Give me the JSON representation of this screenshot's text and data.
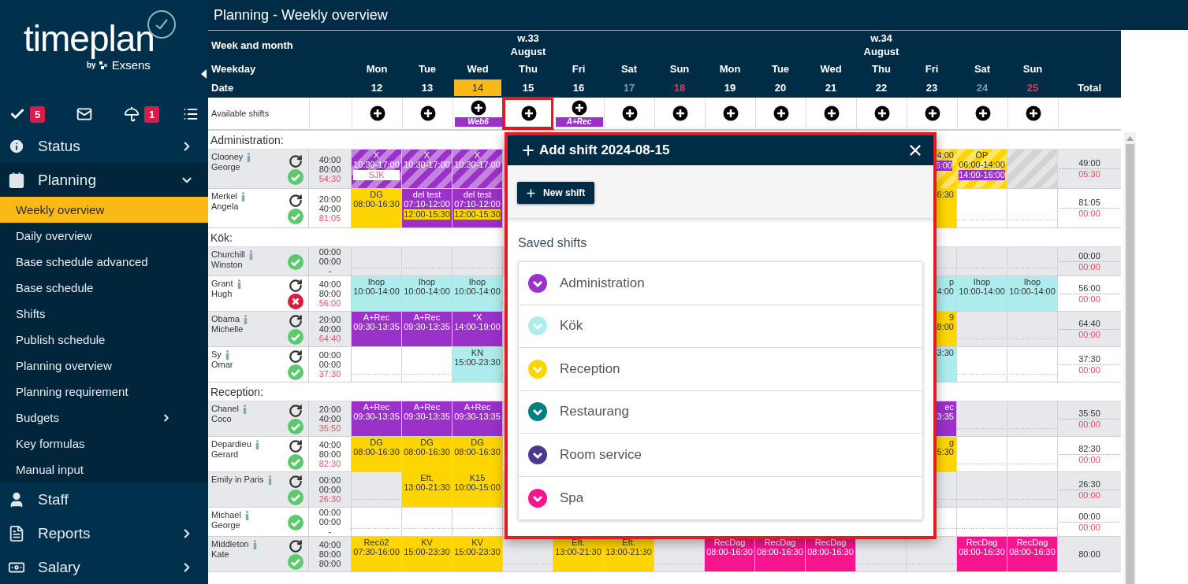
{
  "logo": {
    "name": "timeplan",
    "by": "by",
    "company": "Exsens"
  },
  "quick_icons": [
    {
      "kind": "tasks",
      "badge": "5"
    },
    {
      "kind": "mail"
    },
    {
      "kind": "vacation",
      "badge": "1"
    },
    {
      "kind": "list"
    }
  ],
  "menu": [
    {
      "label": "Status",
      "kind": "info",
      "expandable": true,
      "expanded": false
    },
    {
      "label": "Planning",
      "kind": "calendar",
      "expandable": true,
      "expanded": true,
      "children": [
        {
          "label": "Weekly overview",
          "selected": true
        },
        {
          "label": "Daily overview",
          "selected": false
        },
        {
          "label": "Base schedule advanced",
          "selected": false
        },
        {
          "label": "Base schedule",
          "selected": false
        },
        {
          "label": "Shifts",
          "selected": false
        },
        {
          "label": "Publish schedule",
          "selected": false
        },
        {
          "label": "Planning overview",
          "selected": false
        },
        {
          "label": "Planning requirement",
          "selected": false
        },
        {
          "label": "Budgets",
          "selected": false,
          "expandable": true
        },
        {
          "label": "Key formulas",
          "selected": false
        },
        {
          "label": "Manual input",
          "selected": false
        }
      ]
    },
    {
      "label": "Staff",
      "kind": "user",
      "expandable": false,
      "expanded": false
    },
    {
      "label": "Reports",
      "kind": "document",
      "expandable": true,
      "expanded": false
    },
    {
      "label": "Salary",
      "kind": "money",
      "expandable": true,
      "expanded": false
    }
  ],
  "page_title": "Planning - Weekly overview",
  "grid": {
    "labels": {
      "week": "Week and month",
      "weekday": "Weekday",
      "date": "Date",
      "total": "Total",
      "available": "Available shifts"
    },
    "weeks": [
      {
        "label": "w.33",
        "month": "August",
        "days": [
          {
            "weekday": "Mon",
            "date": "12",
            "kind": "weekday",
            "today": false
          },
          {
            "weekday": "Tue",
            "date": "13",
            "kind": "weekday",
            "today": false
          },
          {
            "weekday": "Wed",
            "date": "14",
            "kind": "weekday",
            "today": true
          },
          {
            "weekday": "Thu",
            "date": "15",
            "kind": "weekday",
            "today": false
          },
          {
            "weekday": "Fri",
            "date": "16",
            "kind": "weekday",
            "today": false
          },
          {
            "weekday": "Sat",
            "date": "17",
            "kind": "saturday",
            "today": false
          },
          {
            "weekday": "Sun",
            "date": "18",
            "kind": "sunday",
            "today": false
          }
        ]
      },
      {
        "label": "w.34",
        "month": "August",
        "days": [
          {
            "weekday": "Mon",
            "date": "19",
            "kind": "weekday",
            "today": false
          },
          {
            "weekday": "Tue",
            "date": "20",
            "kind": "weekday",
            "today": false
          },
          {
            "weekday": "Wed",
            "date": "21",
            "kind": "weekday",
            "today": false
          },
          {
            "weekday": "Thu",
            "date": "22",
            "kind": "weekday",
            "today": false
          },
          {
            "weekday": "Fri",
            "date": "23",
            "kind": "weekday",
            "today": false
          },
          {
            "weekday": "Sat",
            "date": "24",
            "kind": "saturday",
            "today": false
          },
          {
            "weekday": "Sun",
            "date": "25",
            "kind": "sunday",
            "today": false
          }
        ]
      }
    ],
    "available": [
      {
        "selected": false
      },
      {
        "selected": false
      },
      {
        "selected": false,
        "tag": "Web6"
      },
      {
        "selected": true
      },
      {
        "selected": false,
        "tag": "A+Rec"
      },
      {
        "selected": false
      },
      {
        "selected": false
      },
      {
        "selected": false
      },
      {
        "selected": false
      },
      {
        "selected": false
      },
      {
        "selected": false
      },
      {
        "selected": false
      },
      {
        "selected": false
      },
      {
        "selected": false
      }
    ],
    "sections": [
      {
        "title": "Administration:",
        "staff": [
          {
            "last": "Clooney",
            "first": "George",
            "info": true,
            "recurring": true,
            "approved": true,
            "hours": [
              "40:00",
              "80:00",
              "54:30"
            ],
            "balance_alert": true,
            "cells": [
              {
                "color": "#9a31c9",
                "striped": true,
                "lines": [
                  "X",
                  "10:30-17:00"
                ],
                "tag": {
                  "text": "SJK",
                  "color": "#ffffff"
                }
              },
              {
                "color": "#9a31c9",
                "striped": true,
                "lines": [
                  "X",
                  "10:30-17:00"
                ]
              },
              {
                "color": "#9a31c9",
                "striped": true,
                "lines": [
                  "X",
                  "10:30-17:00"
                ]
              },
              {},
              {},
              {},
              {},
              {},
              {},
              {},
              {},
              {
                "color": "#ffd500",
                "striped": true,
                "lines": [
                  "4:00"
                ],
                "tag": {
                  "text": "6:00",
                  "color": "#9a31c9"
                },
                "cut": true
              },
              {
                "color": "#ffd500",
                "striped": true,
                "lines": [
                  "ÖP",
                  "06:00-14:00"
                ],
                "tag": {
                  "text": "14:00-16:00",
                  "color": "#9a31c9"
                }
              },
              {
                "color": "#d3d3d3",
                "striped": true
              }
            ],
            "total": [
              "49:00",
              "05:30"
            ]
          },
          {
            "last": "Merkel",
            "first": "Angela",
            "info": true,
            "recurring": true,
            "approved": true,
            "hours": [
              "20:00",
              "40:00",
              "81:05"
            ],
            "balance_alert": true,
            "cells": [
              {
                "color": "#ffd500",
                "striped": false,
                "lines": [
                  "DG",
                  "08:00-16:30"
                ]
              },
              {
                "color": "#9a31c9",
                "striped": false,
                "lines": [
                  "del test",
                  "07:10-12:00"
                ],
                "tag": {
                  "text": "12:00-15:30",
                  "color": "#ffd500"
                }
              },
              {
                "color": "#9a31c9",
                "striped": false,
                "lines": [
                  "del test",
                  "07:10-12:00"
                ],
                "tag": {
                  "text": "12:00-15:30",
                  "color": "#ffd500"
                }
              },
              {},
              {},
              {},
              {},
              {},
              {},
              {},
              {},
              {
                "color": "#ffd500",
                "striped": false,
                "lines": [
                  "6:30"
                ],
                "cut": true
              },
              {},
              {}
            ],
            "total": [
              "81:05",
              "00:00"
            ]
          }
        ]
      },
      {
        "title": "Kök:",
        "staff": [
          {
            "last": "Churchill",
            "first": "Winston",
            "info": true,
            "recurring": false,
            "approved": true,
            "hours": [
              "00:00",
              "00:00",
              "-"
            ],
            "balance_alert": false,
            "cells": [
              {},
              {},
              {},
              {},
              {},
              {},
              {},
              {},
              {},
              {},
              {},
              {},
              {},
              {}
            ],
            "total": [
              "00:00",
              "00:00"
            ]
          },
          {
            "last": "Grant",
            "first": "Hugh",
            "info": true,
            "recurring": true,
            "approved": false,
            "hours": [
              "40:00",
              "80:00",
              "56:00"
            ],
            "balance_alert": true,
            "cells": [
              {
                "color": "#aeeced",
                "striped": false,
                "lines": [
                  "Ihop",
                  "10:00-14:00"
                ]
              },
              {
                "color": "#aeeced",
                "striped": false,
                "lines": [
                  "Ihop",
                  "10:00-14:00"
                ]
              },
              {
                "color": "#aeeced",
                "striped": false,
                "lines": [
                  "Ihop",
                  "10:00-14:00"
                ]
              },
              {},
              {},
              {},
              {},
              {},
              {},
              {},
              {},
              {
                "color": "#aeeced",
                "striped": false,
                "lines": [
                  "p",
                  "4:00"
                ],
                "cut": true
              },
              {
                "color": "#aeeced",
                "striped": false,
                "lines": [
                  "Ihop",
                  "10:00-14:00"
                ]
              },
              {
                "color": "#aeeced",
                "striped": false,
                "lines": [
                  "Ihop",
                  "10:00-14:00"
                ]
              }
            ],
            "total": [
              "56:00",
              "00:00"
            ]
          },
          {
            "last": "Obama",
            "first": "Michelle",
            "info": true,
            "recurring": true,
            "approved": true,
            "hours": [
              "20:00",
              "40:00",
              "64:40"
            ],
            "balance_alert": true,
            "cells": [
              {
                "color": "#9a31c9",
                "striped": false,
                "lines": [
                  "A+Rec",
                  "09:30-13:35"
                ]
              },
              {
                "color": "#9a31c9",
                "striped": false,
                "lines": [
                  "A+Rec",
                  "09:30-13:35"
                ]
              },
              {
                "color": "#9a31c9",
                "striped": false,
                "lines": [
                  "*X",
                  "14:00-19:00"
                ]
              },
              {},
              {},
              {},
              {},
              {},
              {},
              {},
              {},
              {
                "color": "#ffd500",
                "striped": false,
                "lines": [
                  "9",
                  "8:00"
                ],
                "cut": true
              },
              {},
              {}
            ],
            "total": [
              "64:40",
              "00:00"
            ]
          },
          {
            "last": "Sy",
            "first": "Omar",
            "info": true,
            "recurring": true,
            "approved": true,
            "hours": [
              "00:00",
              "00:00",
              "37:30"
            ],
            "balance_alert": true,
            "cells": [
              {},
              {},
              {
                "color": "#aeeced",
                "striped": false,
                "lines": [
                  "KN",
                  "15:00-23:30"
                ]
              },
              {},
              {},
              {},
              {},
              {},
              {},
              {},
              {},
              {
                "color": "#aeeced",
                "striped": false,
                "lines": [
                  "3:30"
                ],
                "cut": true
              },
              {},
              {}
            ],
            "total": [
              "37:30",
              "00:00"
            ]
          }
        ]
      },
      {
        "title": "Reception:",
        "staff": [
          {
            "last": "Chanel",
            "first": "Coco",
            "info": true,
            "recurring": true,
            "approved": true,
            "hours": [
              "20:00",
              "40:00",
              "35:50"
            ],
            "balance_alert": true,
            "cells": [
              {
                "color": "#9a31c9",
                "striped": false,
                "lines": [
                  "A+Rec",
                  "09:30-13:35"
                ]
              },
              {
                "color": "#9a31c9",
                "striped": false,
                "lines": [
                  "A+Rec",
                  "09:30-13:35"
                ]
              },
              {
                "color": "#9a31c9",
                "striped": false,
                "lines": [
                  "A+Rec",
                  "09:30-13:35"
                ]
              },
              {},
              {},
              {},
              {},
              {},
              {},
              {},
              {},
              {
                "color": "#9a31c9",
                "striped": false,
                "lines": [
                  "ec",
                  "3:35"
                ],
                "cut": true
              },
              {},
              {}
            ],
            "total": [
              "35:50",
              "00:00"
            ]
          },
          {
            "last": "Depardieu",
            "first": "Gerard",
            "info": true,
            "recurring": true,
            "approved": true,
            "hours": [
              "40:00",
              "80:00",
              "82:30"
            ],
            "balance_alert": true,
            "cells": [
              {
                "color": "#ffd500",
                "striped": false,
                "lines": [
                  "DG",
                  "08:00-16:30"
                ]
              },
              {
                "color": "#ffd500",
                "striped": false,
                "lines": [
                  "DG",
                  "08:00-16:30"
                ]
              },
              {
                "color": "#ffd500",
                "striped": false,
                "lines": [
                  "DG",
                  "08:00-16:30"
                ]
              },
              {},
              {},
              {},
              {},
              {},
              {},
              {},
              {},
              {
                "color": "#ffd500",
                "striped": false,
                "lines": [
                  "g",
                  "5:30"
                ],
                "cut": true
              },
              {},
              {}
            ],
            "total": [
              "82:30",
              "00:00"
            ]
          },
          {
            "last": "Emily in Paris",
            "info": true,
            "recurring": true,
            "approved": true,
            "hours": [
              "00:00",
              "00:00",
              "26:30"
            ],
            "balance_alert": true,
            "cells": [
              {},
              {
                "color": "#ffd500",
                "striped": false,
                "lines": [
                  "Eft.",
                  "13:00-21:30"
                ]
              },
              {
                "color": "#ffd500",
                "striped": false,
                "lines": [
                  "K15",
                  "10:00-15:00"
                ]
              },
              {},
              {},
              {},
              {},
              {},
              {},
              {},
              {},
              {},
              {},
              {}
            ],
            "total": [
              "26:30",
              "00:00"
            ]
          },
          {
            "last": "Michael",
            "first": "George",
            "info": true,
            "recurring": false,
            "approved": true,
            "hours": [
              "00:00",
              "00:00",
              "-"
            ],
            "balance_alert": false,
            "cells": [
              {},
              {},
              {},
              {},
              {},
              {},
              {},
              {},
              {},
              {},
              {},
              {},
              {},
              {}
            ],
            "total": [
              "00:00",
              "00:00"
            ]
          },
          {
            "last": "Middleton",
            "first": "Kate",
            "info": true,
            "recurring": true,
            "approved": true,
            "hours": [
              "40:00",
              "80:00",
              "80:00"
            ],
            "balance_alert": false,
            "cells": [
              {
                "color": "#ffd500",
                "striped": false,
                "lines": [
                  "Recö2",
                  "07:30-16:00"
                ]
              },
              {
                "color": "#ffd500",
                "striped": false,
                "lines": [
                  "KV",
                  "15:00-23:30"
                ]
              },
              {
                "color": "#ffd500",
                "striped": false,
                "lines": [
                  "KV",
                  "15:00-23:30"
                ]
              },
              {},
              {
                "color": "#ffd500",
                "striped": false,
                "lines": [
                  "Eft.",
                  "13:00-21:30"
                ]
              },
              {
                "color": "#ffd500",
                "striped": false,
                "lines": [
                  "Eft.",
                  "13:00-21:30"
                ]
              },
              {},
              {
                "color": "#f7148f",
                "striped": false,
                "lines": [
                  "RecDag",
                  "08:00-16:30"
                ]
              },
              {
                "color": "#f7148f",
                "striped": false,
                "lines": [
                  "RecDag",
                  "08:00-16:30"
                ]
              },
              {
                "color": "#f7148f",
                "striped": false,
                "lines": [
                  "RecDag",
                  "08:00-16:30"
                ]
              },
              {},
              {},
              {
                "color": "#f7148f",
                "striped": false,
                "lines": [
                  "RecDag",
                  "08:00-16:30"
                ]
              },
              {
                "color": "#f7148f",
                "striped": false,
                "lines": [
                  "RecDag",
                  "08:00-16:30"
                ]
              }
            ],
            "total": [
              "80:00"
            ]
          }
        ]
      }
    ]
  },
  "dialog": {
    "title": "Add shift 2024-08-15",
    "new_button": "New shift",
    "saved_label": "Saved shifts",
    "groups": [
      {
        "label": "Administration",
        "color": "#9a31c9"
      },
      {
        "label": "Kök",
        "color": "#aeeced"
      },
      {
        "label": "Reception",
        "color": "#ffd500"
      },
      {
        "label": "Restaurang",
        "color": "#008080"
      },
      {
        "label": "Room service",
        "color": "#4b3a8c"
      },
      {
        "label": "Spa",
        "color": "#f7148f"
      }
    ]
  }
}
